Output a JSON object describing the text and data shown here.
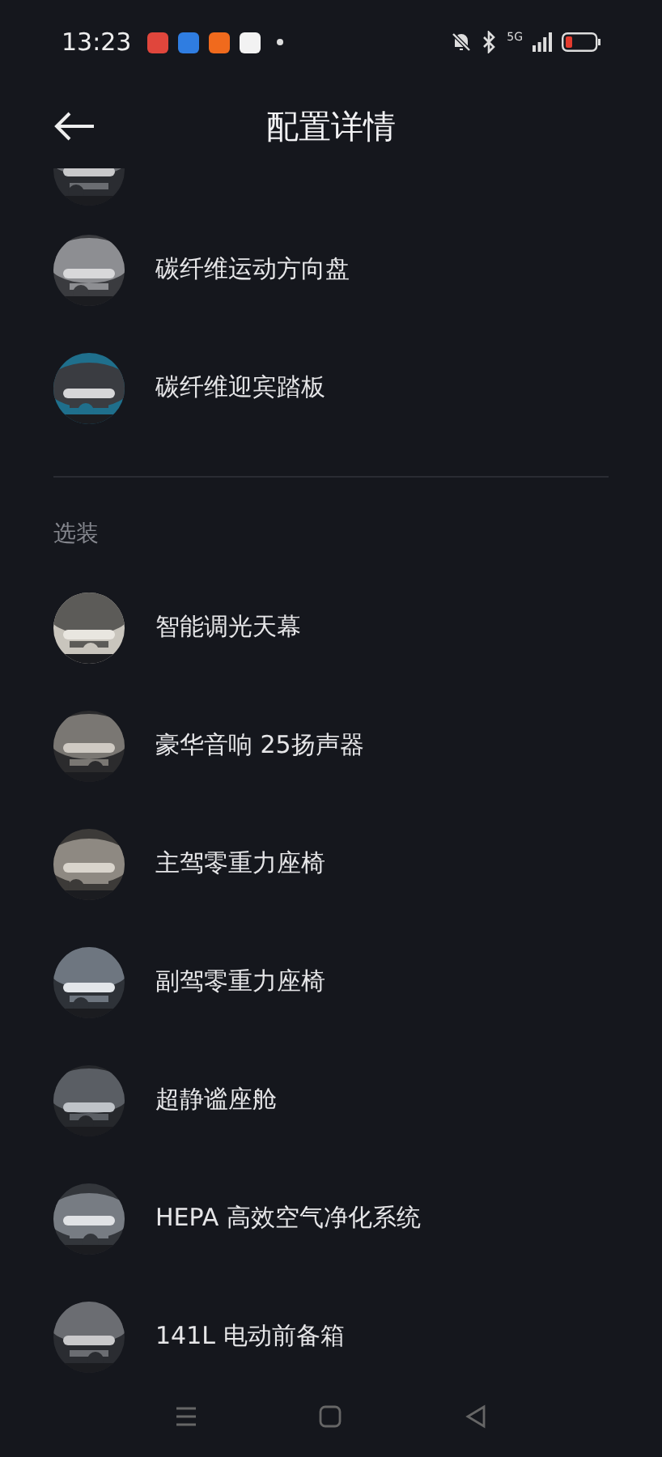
{
  "status_bar": {
    "time": "13:23",
    "network": "5G"
  },
  "header": {
    "title": "配置详情"
  },
  "standard": {
    "items": [
      {
        "label": "碳纤维运动方向盘"
      },
      {
        "label": "碳纤维迎宾踏板"
      }
    ]
  },
  "optional": {
    "title": "选装",
    "items": [
      {
        "label": "智能调光天幕"
      },
      {
        "label": "豪华音响 25扬声器"
      },
      {
        "label": "主驾零重力座椅"
      },
      {
        "label": "副驾零重力座椅"
      },
      {
        "label": "超静谧座舱"
      },
      {
        "label": "HEPA 高效空气净化系统"
      },
      {
        "label": "141L 电动前备箱"
      }
    ]
  }
}
